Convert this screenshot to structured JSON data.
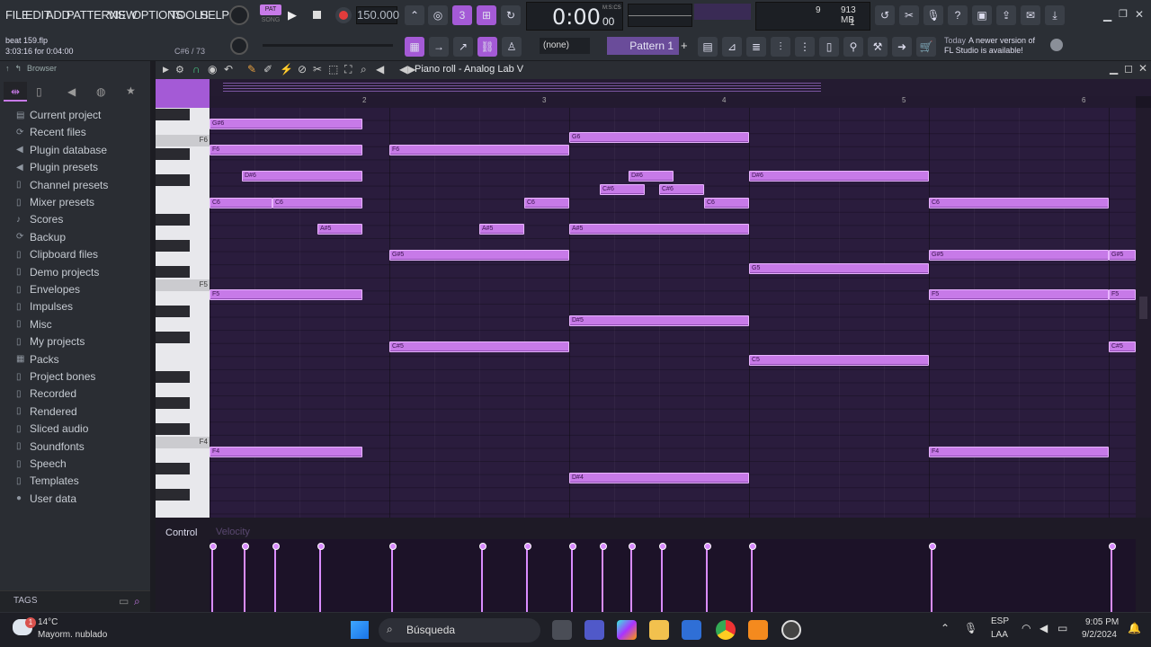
{
  "menu": [
    "FILE",
    "EDIT",
    "ADD",
    "PATTERNS",
    "VIEW",
    "OPTIONS",
    "TOOLS",
    "HELP"
  ],
  "transport": {
    "pat": "PAT",
    "song": "SONG",
    "tempo": "150.000",
    "time": "0:00",
    "time_small": "00",
    "mcs": "M:S:CS"
  },
  "cpu": {
    "val": "9",
    "mem": "913 MB",
    "poly": "1"
  },
  "project": {
    "file": "beat 159.flp",
    "time": "3:03:16 for 0:04:00",
    "hint": "C#6 / 73"
  },
  "toolbar2": {
    "snap": "(none)",
    "pattern": "Pattern 1"
  },
  "news": {
    "line1": "Today",
    "line2": "A newer version of",
    "line3": "FL Studio is available!"
  },
  "browser": {
    "title": "Browser",
    "items": [
      "Current project",
      "Recent files",
      "Plugin database",
      "Plugin presets",
      "Channel presets",
      "Mixer presets",
      "Scores",
      "Backup",
      "Clipboard files",
      "Demo projects",
      "Envelopes",
      "Impulses",
      "Misc",
      "My projects",
      "Packs",
      "Project bones",
      "Recorded",
      "Rendered",
      "Sliced audio",
      "Soundfonts",
      "Speech",
      "Templates",
      "User data"
    ],
    "tags": "TAGS"
  },
  "pianoroll": {
    "title": "Piano roll - Analog Lab V",
    "ruler": [
      "2",
      "3",
      "4",
      "5",
      "6"
    ],
    "key_labels": [
      "F6",
      "F5",
      "F4"
    ],
    "control": "Control",
    "velocity": "Velocity",
    "notes": [
      {
        "label": "G#6",
        "bar": 1.0,
        "len": 0.85,
        "row": 0
      },
      {
        "label": "G6",
        "bar": 3.0,
        "len": 1.0,
        "row": 1
      },
      {
        "label": "F6",
        "bar": 1.0,
        "len": 0.85,
        "row": 2
      },
      {
        "label": "F6",
        "bar": 2.0,
        "len": 1.0,
        "row": 2
      },
      {
        "label": "D#6",
        "bar": 1.18,
        "len": 0.67,
        "row": 4
      },
      {
        "label": "D#6",
        "bar": 3.33,
        "len": 0.25,
        "row": 4
      },
      {
        "label": "D#6",
        "bar": 4.0,
        "len": 1.0,
        "row": 4
      },
      {
        "label": "C#6",
        "bar": 3.17,
        "len": 0.25,
        "row": 5
      },
      {
        "label": "C#6",
        "bar": 3.5,
        "len": 0.25,
        "row": 5
      },
      {
        "label": "C6",
        "bar": 1.0,
        "len": 0.35,
        "row": 6
      },
      {
        "label": "C6",
        "bar": 1.35,
        "len": 0.5,
        "row": 6
      },
      {
        "label": "C6",
        "bar": 2.75,
        "len": 0.25,
        "row": 6
      },
      {
        "label": "C6",
        "bar": 3.75,
        "len": 0.25,
        "row": 6
      },
      {
        "label": "C6",
        "bar": 5.0,
        "len": 1.0,
        "row": 6
      },
      {
        "label": "A#5",
        "bar": 1.6,
        "len": 0.25,
        "row": 8
      },
      {
        "label": "A#5",
        "bar": 2.5,
        "len": 0.25,
        "row": 8
      },
      {
        "label": "A#5",
        "bar": 3.0,
        "len": 1.0,
        "row": 8
      },
      {
        "label": "G#5",
        "bar": 2.0,
        "len": 1.0,
        "row": 10
      },
      {
        "label": "G#5",
        "bar": 5.0,
        "len": 1.0,
        "row": 10
      },
      {
        "label": "G#5",
        "bar": 6.0,
        "len": 0.3,
        "row": 10
      },
      {
        "label": "G5",
        "bar": 4.0,
        "len": 1.0,
        "row": 11
      },
      {
        "label": "F5",
        "bar": 1.0,
        "len": 0.85,
        "row": 13
      },
      {
        "label": "F5",
        "bar": 5.0,
        "len": 1.0,
        "row": 13
      },
      {
        "label": "F5",
        "bar": 6.0,
        "len": 0.3,
        "row": 13
      },
      {
        "label": "D#5",
        "bar": 3.0,
        "len": 1.0,
        "row": 15
      },
      {
        "label": "C#5",
        "bar": 2.0,
        "len": 1.0,
        "row": 17
      },
      {
        "label": "C#5",
        "bar": 6.0,
        "len": 0.3,
        "row": 17
      },
      {
        "label": "C5",
        "bar": 4.0,
        "len": 1.0,
        "row": 18
      },
      {
        "label": "F4",
        "bar": 1.0,
        "len": 0.85,
        "row": 25
      },
      {
        "label": "F4",
        "bar": 5.0,
        "len": 1.0,
        "row": 25
      },
      {
        "label": "D#4",
        "bar": 3.0,
        "len": 1.0,
        "row": 27
      }
    ],
    "vel_bars": [
      1.0,
      1.18,
      1.35,
      1.6,
      2.0,
      2.5,
      2.75,
      3.0,
      3.17,
      3.33,
      3.5,
      3.75,
      4.0,
      5.0,
      6.0
    ]
  },
  "taskbar": {
    "weather_temp": "14°C",
    "weather_desc": "Mayorm. nublado",
    "badge": "1",
    "search": "Búsqueda",
    "lang1": "ESP",
    "lang2": "LAA",
    "time": "9:05 PM",
    "date": "9/2/2024"
  },
  "colors": {
    "note": "#c77ae8",
    "grid": "#2a1c3d",
    "accent": "#b05ce8"
  }
}
